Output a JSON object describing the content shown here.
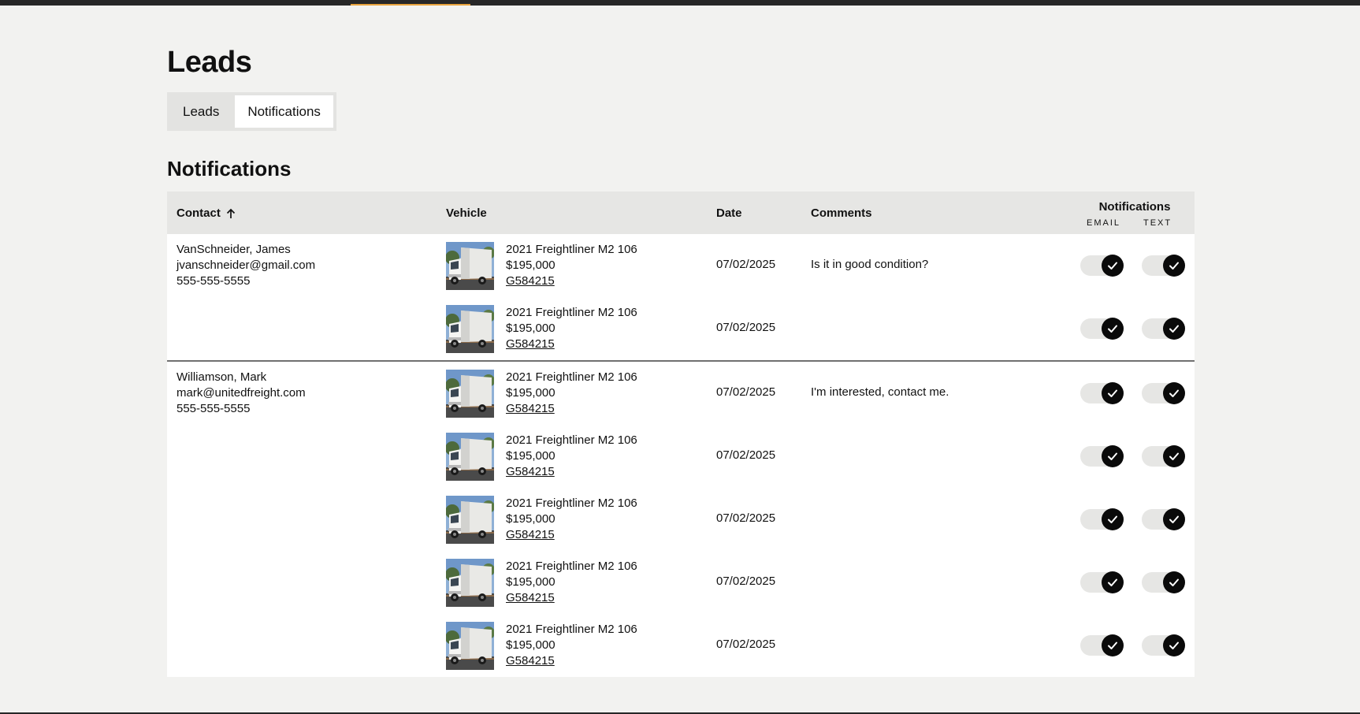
{
  "page": {
    "title": "Leads"
  },
  "tabs": [
    {
      "label": "Leads",
      "active": false
    },
    {
      "label": "Notifications",
      "active": true
    }
  ],
  "section": {
    "title": "Notifications"
  },
  "table": {
    "headers": {
      "contact": "Contact",
      "vehicle": "Vehicle",
      "date": "Date",
      "comments": "Comments",
      "notifications": "Notifications",
      "email": "EMAIL",
      "text": "TEXT"
    },
    "sort": {
      "column": "contact",
      "direction": "ascending",
      "icon": "arrow-up-icon"
    },
    "groups": [
      {
        "contact": {
          "name": "VanSchneider, James",
          "email": "jvanschneider@gmail.com",
          "phone": "555-555-5555"
        },
        "rows": [
          {
            "vehicle": "2021 Freightliner M2 106",
            "price": "$195,000",
            "stock": "G584215",
            "date": "07/02/2025",
            "comment": "Is it in good condition?",
            "email_on": true,
            "text_on": true
          },
          {
            "vehicle": "2021 Freightliner M2 106",
            "price": "$195,000",
            "stock": "G584215",
            "date": "07/02/2025",
            "comment": "",
            "email_on": true,
            "text_on": true
          }
        ]
      },
      {
        "contact": {
          "name": "Williamson, Mark",
          "email": "mark@unitedfreight.com",
          "phone": "555-555-5555"
        },
        "rows": [
          {
            "vehicle": "2021 Freightliner M2 106",
            "price": "$195,000",
            "stock": "G584215",
            "date": "07/02/2025",
            "comment": "I'm interested, contact me.",
            "email_on": true,
            "text_on": true
          },
          {
            "vehicle": "2021 Freightliner M2 106",
            "price": "$195,000",
            "stock": "G584215",
            "date": "07/02/2025",
            "comment": "",
            "email_on": true,
            "text_on": true
          },
          {
            "vehicle": "2021 Freightliner M2 106",
            "price": "$195,000",
            "stock": "G584215",
            "date": "07/02/2025",
            "comment": "",
            "email_on": true,
            "text_on": true
          },
          {
            "vehicle": "2021 Freightliner M2 106",
            "price": "$195,000",
            "stock": "G584215",
            "date": "07/02/2025",
            "comment": "",
            "email_on": true,
            "text_on": true
          },
          {
            "vehicle": "2021 Freightliner M2 106",
            "price": "$195,000",
            "stock": "G584215",
            "date": "07/02/2025",
            "comment": "",
            "email_on": true,
            "text_on": true
          }
        ]
      }
    ]
  },
  "colors": {
    "accent": "#e8a33d",
    "topbar": "#272727",
    "background": "#f2f2f0",
    "toggle_on": "#0a0a0a"
  }
}
